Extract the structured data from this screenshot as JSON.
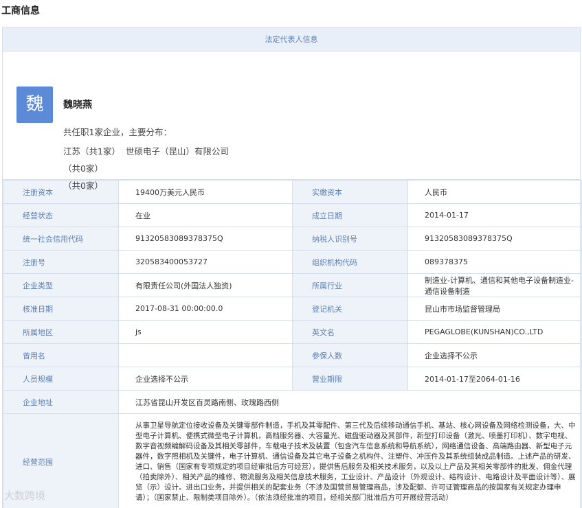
{
  "page_title": "工商信息",
  "representative": {
    "section_title": "法定代表人信息",
    "avatar_char": "魏",
    "name": "魏晓燕",
    "summary": "共任职1家企业，主要分布：",
    "distribution": [
      {
        "region": "江苏（共1家）",
        "company": "世硕电子（昆山）有限公司"
      },
      {
        "region": "（共0家）",
        "company": ""
      },
      {
        "region": "（共0家）",
        "company": ""
      }
    ]
  },
  "info": {
    "rows": [
      {
        "l1": "注册资本",
        "v1": "19400万美元人民币",
        "l2": "实缴资本",
        "v2": "人民币"
      },
      {
        "l1": "经营状态",
        "v1": "在业",
        "l2": "成立日期",
        "v2": "2014-01-17"
      },
      {
        "l1": "统一社会信用代码",
        "v1": "91320583089378375Q",
        "l2": "纳税人识别号",
        "v2": "91320583089378375Q"
      },
      {
        "l1": "注册号",
        "v1": "320583400053727",
        "l2": "组织机构代码",
        "v2": "089378375"
      },
      {
        "l1": "企业类型",
        "v1": "有限责任公司(外国法人独资)",
        "l2": "所属行业",
        "v2": "制造业-计算机、通信和其他电子设备制造业-通信设备制造"
      },
      {
        "l1": "核准日期",
        "v1": "2017-08-31 00:00:00.0",
        "l2": "登记机关",
        "v2": "昆山市市场监督管理局"
      },
      {
        "l1": "所属地区",
        "v1": "js",
        "l2": "英文名",
        "v2": "PEGAGLOBE(KUNSHAN)CO.,LTD"
      },
      {
        "l1": "曾用名",
        "v1": "",
        "l2": "参保人数",
        "v2": "企业选择不公示"
      },
      {
        "l1": "人员规模",
        "v1": "企业选择不公示",
        "l2": "营业期限",
        "v2": "2014-01-17至2064-01-16"
      }
    ],
    "address_label": "企业地址",
    "address": "江苏省昆山开发区百灵路南侧、玫瑰路西侧",
    "scope_label": "经营范围",
    "scope": "从事卫星导航定位接收设备及关键零部件制造，手机及其零配件、第三代及后续移动通信手机、基站、核心网设备及网络检测设备，大、中型电子计算机、便携式微型电子计算机，高档服务器、大容量光、磁盘驱动器及其部件，新型打印设备（激光、喷墨打印机）、数字电视、数字音视频编解码设备及其相关零部件，车载电子技术及装置（包含汽车信息系统和导航系统），网络通信设备、高端路由器、新型电子元器件，数字照相机及关键件，电子计算机、通信设备及其它电子设备之机构件、注塑件、冲压件及其系统组装成品制造。上述产品的研发、进口、销售（国家有专项规定的项目经审批后方可经营），提供售后服务及相关技术服务，以及以上产品及其相关零部件的批发、佣金代理（拍卖除外）、相关产品的维修、物流服务及相关信息技术服务，工业设计、产品设计（外观设计、结构设计、电路设计及平面设计等）、展览（示）设计。进出口业务，并提供相关的配套业务（不涉及国营贸易管理商品，涉及配额、许可证管理商品的按国家有关规定办理申请）；（国家禁止、限制类项目除外）。（依法须经批准的项目，经相关部门批准后方可开展经营活动）"
  },
  "watermark": "大数跨境"
}
